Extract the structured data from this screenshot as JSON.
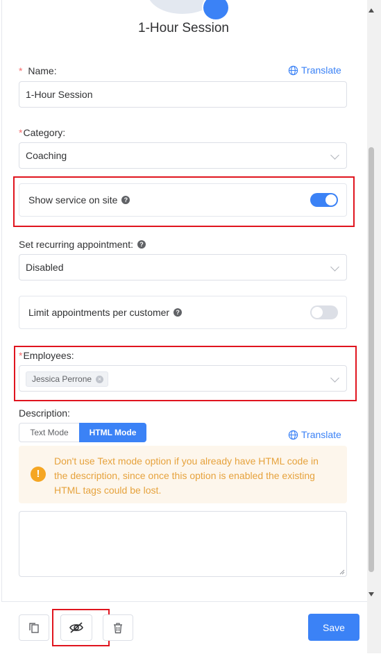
{
  "header": {
    "title": "1-Hour Session"
  },
  "form": {
    "name": {
      "label": "Name:",
      "value": "1-Hour Session",
      "translate_label": "Translate"
    },
    "category": {
      "label": "Category:",
      "value": "Coaching"
    },
    "show_on_site": {
      "label": "Show service on site",
      "enabled": true
    },
    "recurring": {
      "label": "Set recurring appointment:",
      "value": "Disabled"
    },
    "limit": {
      "label": "Limit appointments per customer",
      "enabled": false
    },
    "employees": {
      "label": "Employees:",
      "selected": [
        "Jessica Perrone"
      ]
    },
    "description": {
      "label": "Description:",
      "modes": [
        "Text Mode",
        "HTML Mode"
      ],
      "active_mode": "HTML Mode",
      "translate_label": "Translate",
      "warning": "Don't use Text mode option if you already have HTML code in the description, since once this option is enabled the existing HTML tags could be lost.",
      "value": ""
    }
  },
  "footer": {
    "save_label": "Save"
  },
  "colors": {
    "accent": "#3b82f6",
    "required": "#f56c6c",
    "highlight": "#e0141e",
    "warning": "#e6a23c"
  }
}
